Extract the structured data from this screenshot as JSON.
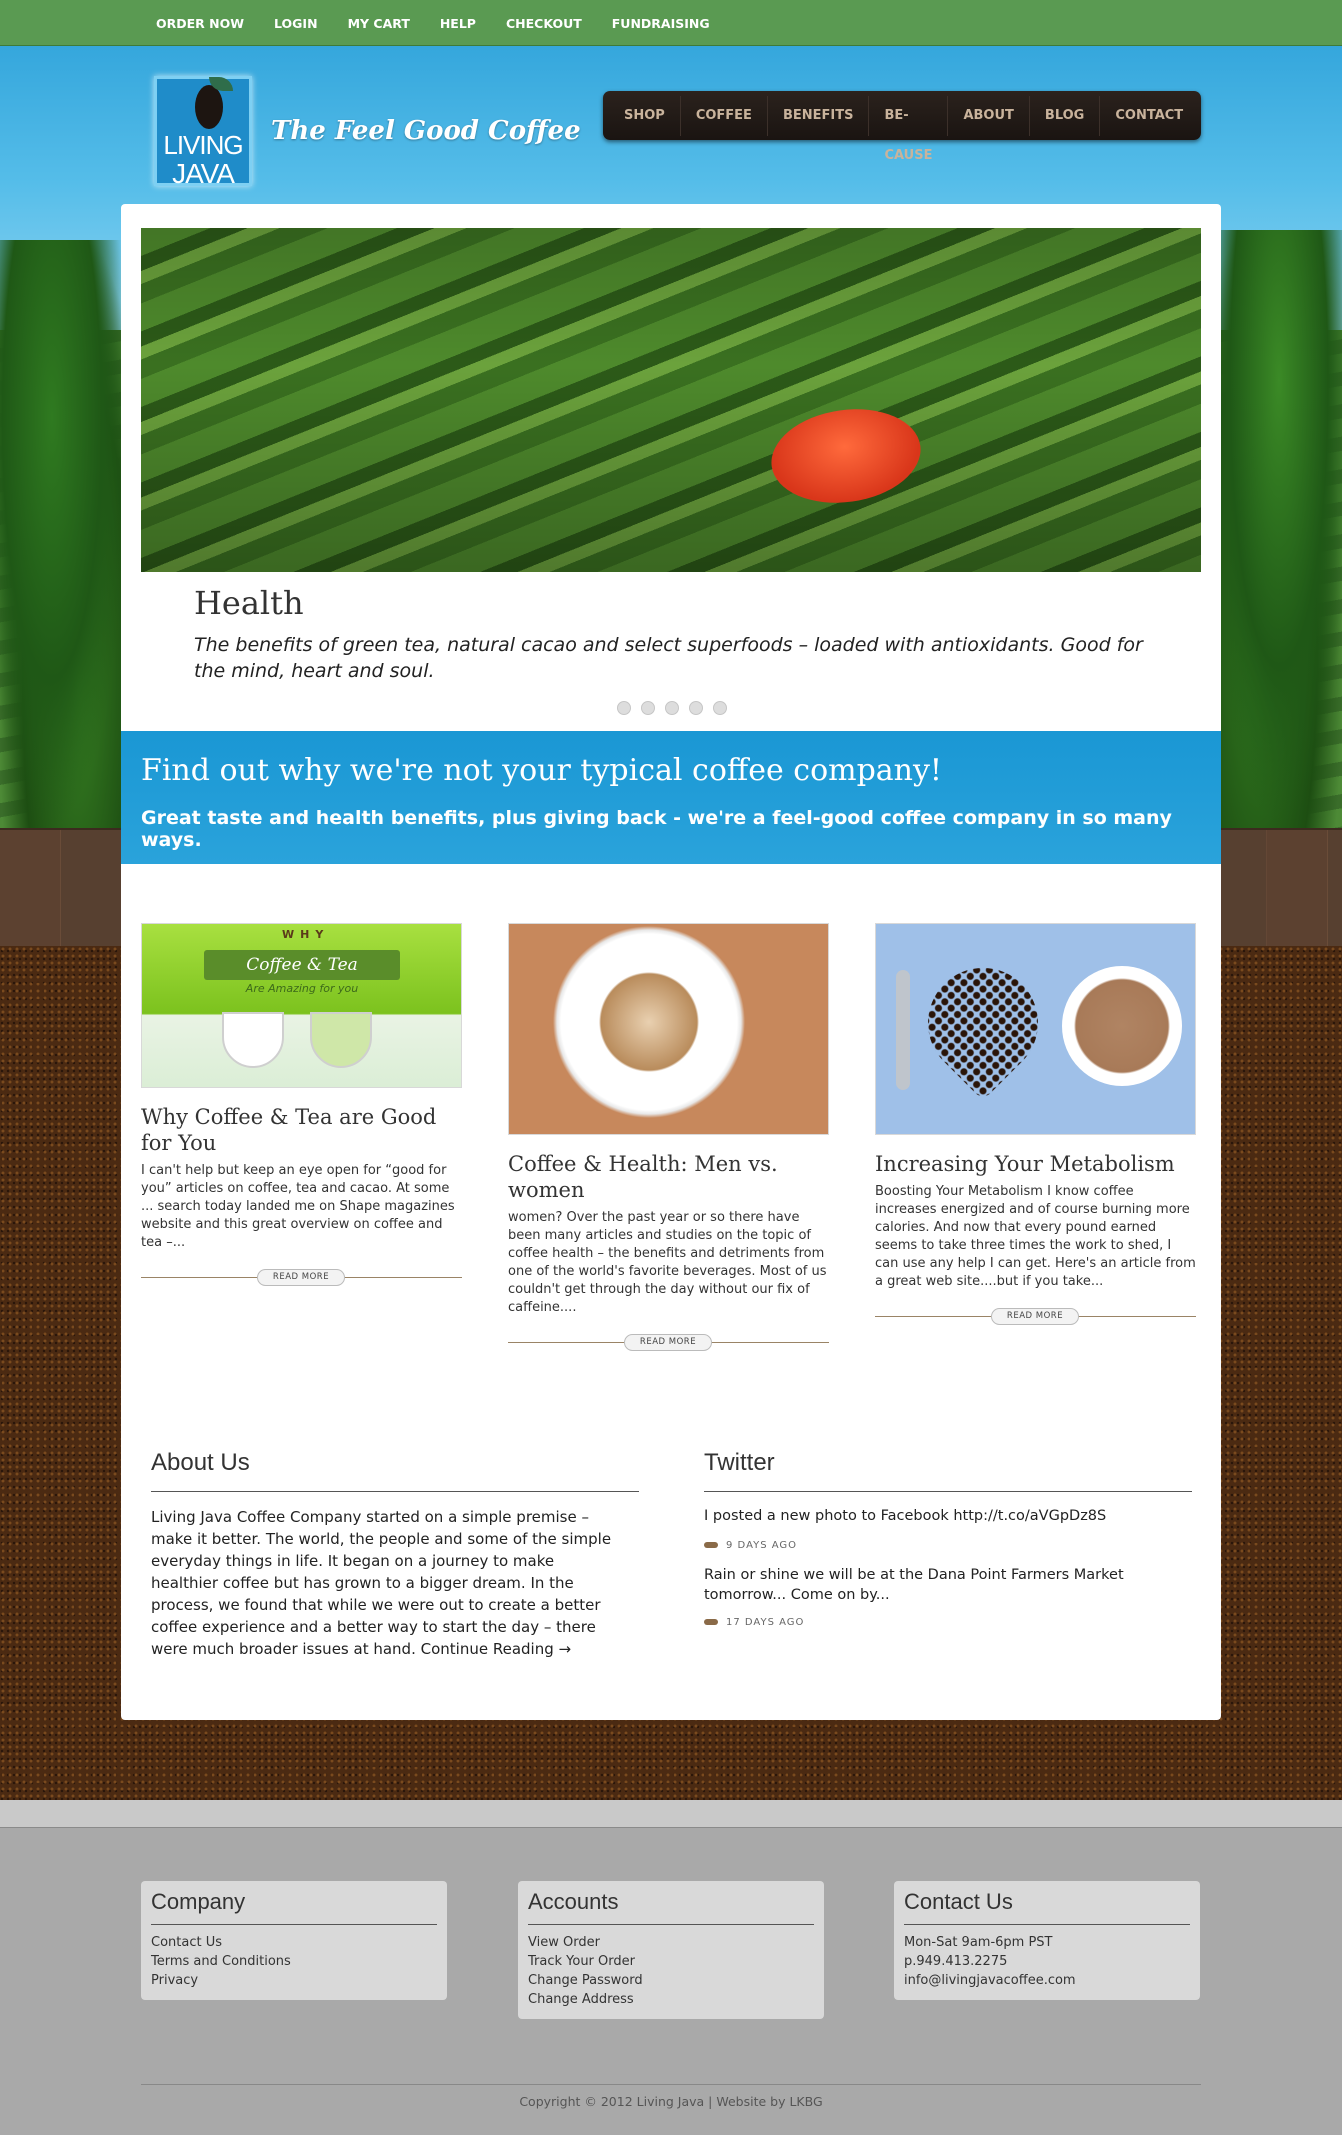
{
  "topbar": {
    "items": [
      "ORDER NOW",
      "LOGIN",
      "MY CART",
      "HELP",
      "CHECKOUT",
      "FUNDRAISING"
    ]
  },
  "logo": {
    "line1": "LIVING",
    "line2": "JAVA"
  },
  "tagline": "The Feel Good Coffee",
  "mainnav": {
    "items": [
      "SHOP",
      "COFFEE",
      "BENEFITS",
      "BE-CAUSE",
      "ABOUT",
      "BLOG",
      "CONTACT"
    ]
  },
  "slider": {
    "title": "Health",
    "caption": "The benefits of green tea, natural cacao and select superfoods – loaded with antioxidants. Good for the mind, heart and soul.",
    "dot_count": 5
  },
  "band": {
    "heading": "Find out why we're not your typical coffee company!",
    "sub": "Great taste and health benefits, plus giving back - we're a feel-good coffee company in so many ways."
  },
  "cards": [
    {
      "title": "Why Coffee & Tea are Good for You",
      "excerpt": "I can't help but keep an eye open for “good for you” articles on coffee, tea and cacao. At some ... search today landed me on Shape magazines website and this great overview on coffee and tea –...",
      "read_more": "READ MORE",
      "image_banner": "Coffee & Tea",
      "image_top": "WHY",
      "image_sub": "Are Amazing for you"
    },
    {
      "title": "Coffee & Health: Men vs. women",
      "excerpt": "women? Over the past year or so there have been many articles and studies on the topic of coffee health – the benefits and detriments from one of the world's favorite beverages. Most of us couldn't get through the day without our fix of caffeine....",
      "read_more": "READ MORE"
    },
    {
      "title": "Increasing Your Metabolism",
      "excerpt": "Boosting Your Metabolism I know coffee increases energized and of course burning more calories. And now that every pound earned seems to take three times the work to shed, I can use any help I can get. Here's an article from a great web site....but if you take...",
      "read_more": "READ MORE"
    }
  ],
  "about": {
    "heading": "About Us",
    "text": "Living Java Coffee Company started on a simple premise – make it better. The world, the people and some of the simple everyday things in life. It began on a journey to make healthier coffee but has grown to a bigger dream. In the process, we found that while we were out to create a better coffee experience and a better way to start the day – there were much broader issues at hand.",
    "link": "Continue Reading →"
  },
  "twitter": {
    "heading": "Twitter",
    "tweets": [
      {
        "text": "I posted a new photo to Facebook http://t.co/aVGpDz8S",
        "time": "9 DAYS AGO"
      },
      {
        "text": "Rain or shine we will be at the Dana Point Farmers Market tomorrow... Come on by...",
        "time": "17 DAYS AGO"
      }
    ]
  },
  "footer": {
    "company": {
      "heading": "Company",
      "links": [
        "Contact Us",
        "Terms and Conditions",
        "Privacy"
      ]
    },
    "accounts": {
      "heading": "Accounts",
      "links": [
        "View Order",
        "Track Your Order",
        "Change Password",
        "Change Address"
      ]
    },
    "contact": {
      "heading": "Contact Us",
      "lines": [
        "Mon-Sat 9am-6pm PST",
        "p.949.413.2275",
        "info@livingjavacoffee.com"
      ]
    },
    "copyright": "Copyright © 2012 Living Java | Website by LKBG"
  },
  "colors": {
    "topbar": "#5a9a52",
    "band": "#1a97d4",
    "nav": "#1a1411",
    "footer": "#a9a9a9"
  }
}
